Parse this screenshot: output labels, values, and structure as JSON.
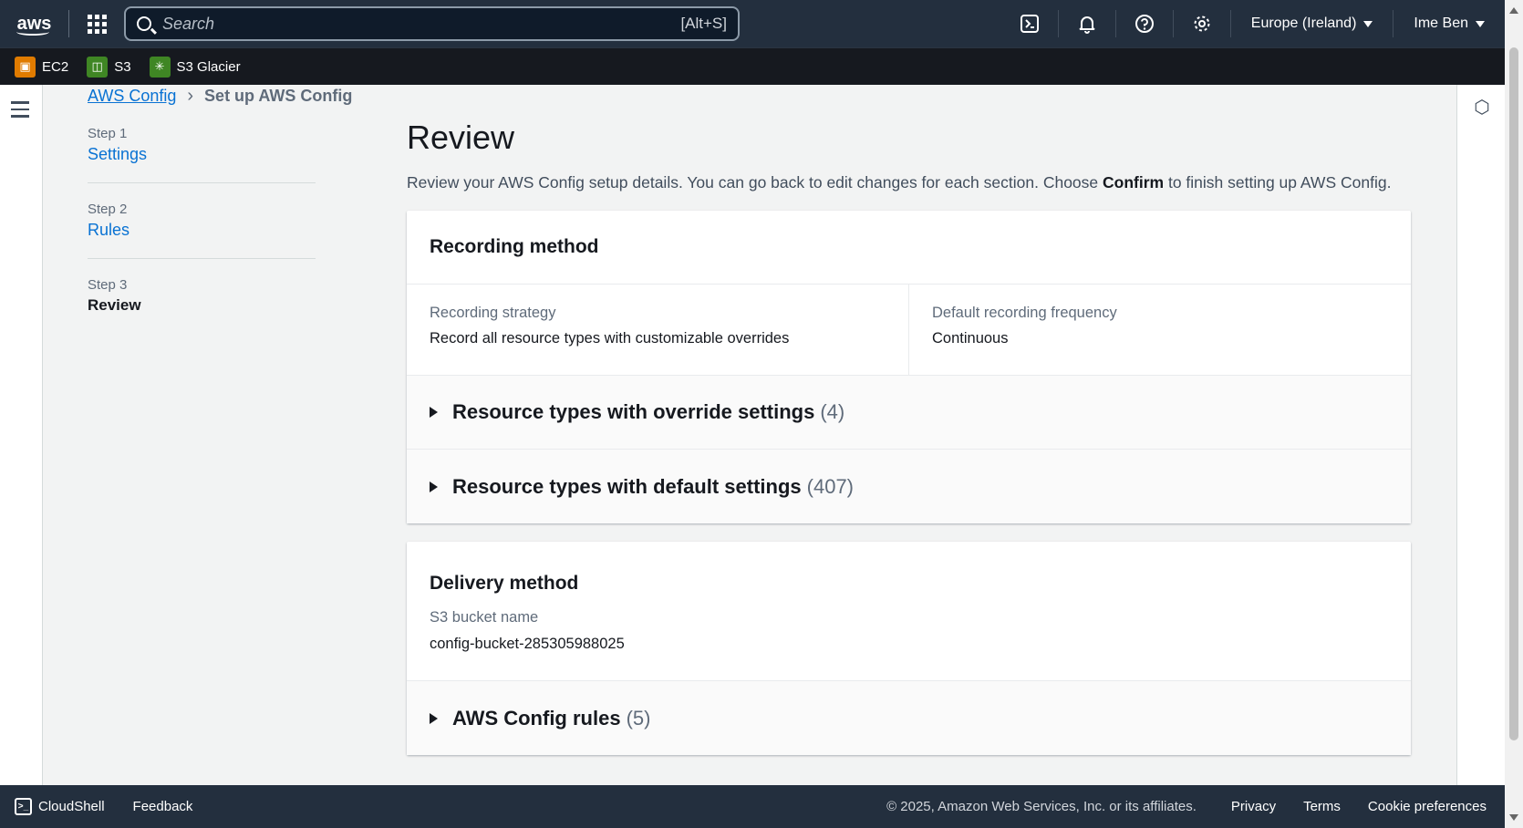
{
  "topnav": {
    "logo": "aws",
    "search_placeholder": "Search",
    "search_shortcut": "[Alt+S]",
    "region": "Europe (Ireland)",
    "user": "Ime Ben"
  },
  "favorites": [
    {
      "label": "EC2",
      "color": "#e07b00",
      "icon": "ec2-icon"
    },
    {
      "label": "S3",
      "color": "#3f8624",
      "icon": "s3-bucket-icon"
    },
    {
      "label": "S3 Glacier",
      "color": "#3f8624",
      "icon": "glacier-icon"
    }
  ],
  "breadcrumb": {
    "root": "AWS Config",
    "current": "Set up AWS Config"
  },
  "steps": [
    {
      "num": "Step 1",
      "name": "Settings"
    },
    {
      "num": "Step 2",
      "name": "Rules"
    },
    {
      "num": "Step 3",
      "name": "Review"
    }
  ],
  "page": {
    "title": "Review",
    "desc_before": "Review your AWS Config setup details. You can go back to edit changes for each section. Choose ",
    "desc_bold": "Confirm",
    "desc_after": " to finish setting up AWS Config."
  },
  "recording": {
    "header": "Recording method",
    "strategy_label": "Recording strategy",
    "strategy_value": "Record all resource types with customizable overrides",
    "frequency_label": "Default recording frequency",
    "frequency_value": "Continuous",
    "override_label": "Resource types with override settings",
    "override_count": "(4)",
    "default_label": "Resource types with default settings",
    "default_count": "(407)"
  },
  "delivery": {
    "header": "Delivery method",
    "bucket_label": "S3 bucket name",
    "bucket_value": "config-bucket-285305988025",
    "rules_label": "AWS Config rules",
    "rules_count": "(5)"
  },
  "footer": {
    "cloudshell": "CloudShell",
    "feedback": "Feedback",
    "copyright": "© 2025, Amazon Web Services, Inc. or its affiliates.",
    "privacy": "Privacy",
    "terms": "Terms",
    "cookies": "Cookie preferences"
  }
}
